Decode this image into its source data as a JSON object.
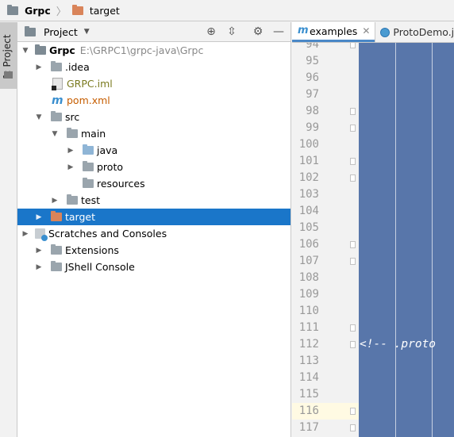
{
  "breadcrumb": {
    "project": "Grpc",
    "folder": "target"
  },
  "toolstrip": {
    "project_tool_label": "1: Project"
  },
  "project_panel": {
    "title": "Project",
    "tree": {
      "root_name": "Grpc",
      "root_path": "E:\\GRPC1\\grpc-java\\Grpc",
      "idea": ".idea",
      "iml": "GRPC.iml",
      "pom": "pom.xml",
      "src": "src",
      "main": "main",
      "java": "java",
      "proto": "proto",
      "resources": "resources",
      "test": "test",
      "target": "target",
      "scratches": "Scratches and Consoles",
      "extensions": "Extensions",
      "jshell": "JShell Console"
    }
  },
  "editor": {
    "tabs": [
      {
        "label": "examples"
      },
      {
        "label": "ProtoDemo.ja"
      }
    ],
    "line_numbers": [
      "94",
      "95",
      "96",
      "97",
      "98",
      "99",
      "100",
      "101",
      "102",
      "103",
      "104",
      "105",
      "106",
      "107",
      "108",
      "109",
      "110",
      "111",
      "112",
      "113",
      "114",
      "115",
      "116",
      "117"
    ],
    "code_line_112": "<!-- .proto",
    "caret_line": "116"
  },
  "colors": {
    "selection": "#1a76c9",
    "code_selection_bg": "#5876aa",
    "caret_line_bg": "#fffae3"
  }
}
